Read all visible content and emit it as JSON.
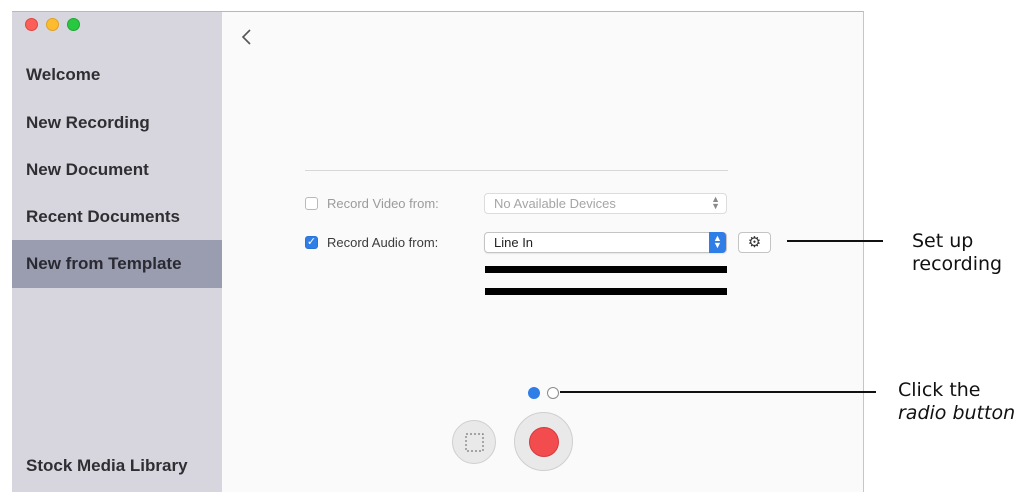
{
  "sidebar": {
    "items": [
      {
        "label": "Welcome"
      },
      {
        "label": "New Recording"
      },
      {
        "label": "New Document"
      },
      {
        "label": "Recent Documents"
      },
      {
        "label": "New from Template",
        "selected": true
      },
      {
        "label": "Stock Media Library"
      }
    ]
  },
  "toolbar": {
    "back_icon": "chevron-left-icon"
  },
  "recording_setup": {
    "video": {
      "label": "Record Video from:",
      "checked": false,
      "value": "No Available Devices"
    },
    "audio": {
      "label": "Record Audio from:",
      "checked": true,
      "value": "Line In"
    },
    "settings_icon": "gear-icon",
    "audio_level_bars": 2
  },
  "pager": {
    "page_count": 2,
    "active_page": 1
  },
  "actions": {
    "region_icon": "dashed-square-icon",
    "record_icon": "record-icon"
  },
  "annotations": {
    "setup": {
      "line1": "Set up",
      "line2": "recording"
    },
    "radio": {
      "line1": "Click the",
      "line2": "radio button"
    }
  },
  "colors": {
    "accent": "#2f7ee8",
    "sidebar": "#d7d6de",
    "selected": "#9a9caf",
    "record": "#f24c4f"
  }
}
